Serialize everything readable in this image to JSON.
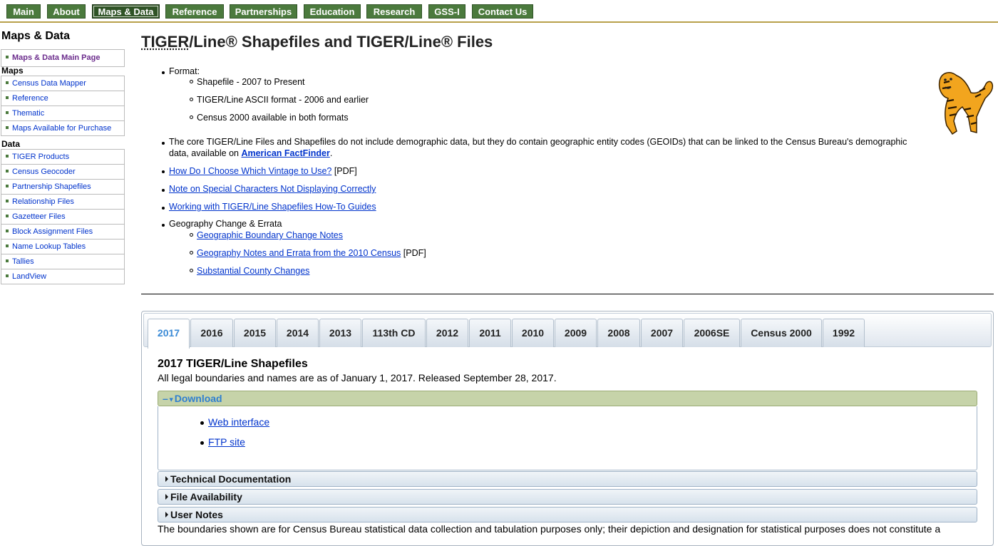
{
  "nav": {
    "items": [
      "Main",
      "About",
      "Maps & Data",
      "Reference",
      "Partnerships",
      "Education",
      "Research",
      "GSS-I",
      "Contact Us"
    ],
    "active": "Maps & Data"
  },
  "sidebar": {
    "heading": "Maps & Data",
    "main_link": "Maps & Data Main Page",
    "maps_heading": "Maps",
    "maps_items": [
      "Census Data Mapper",
      "Reference",
      "Thematic",
      "Maps Available for Purchase"
    ],
    "data_heading": "Data",
    "data_items": [
      "TIGER Products",
      "Census Geocoder",
      "Partnership Shapefiles",
      "Relationship Files",
      "Gazetteer Files",
      "Block Assignment Files",
      "Name Lookup Tables",
      "Tallies",
      "LandView"
    ]
  },
  "page": {
    "title_tiger": "TIGER",
    "title_rest": "/Line® Shapefiles and TIGER/Line® Files",
    "format_label": "Format:",
    "format_items": [
      "Shapefile - 2007 to Present",
      "TIGER/Line ASCII format - 2006 and earlier",
      "Census 2000 available in both formats"
    ],
    "core_text_1": "The core TIGER/Line Files and Shapefiles do not include demographic data, but they do contain geographic entity codes (GEOIDs) that can be linked to the Census Bureau's demographic",
    "core_text_2": "data, available on ",
    "core_link": "American FactFinder",
    "core_end": ".",
    "vintage_link": "How Do I Choose Which Vintage to Use?",
    "pdf_tag": " [PDF]",
    "special_chars_link": "Note on Special Characters Not Displaying Correctly",
    "howto_link": "Working with TIGER/Line Shapefiles How-To Guides",
    "geo_change_label": "Geography Change & Errata",
    "geo_boundary_link": "Geographic Boundary Change Notes",
    "geo_notes_link": "Geography Notes and Errata from the 2010 Census",
    "geo_notes_pdf": " [PDF]",
    "county_link": "Substantial County Changes"
  },
  "tabs": {
    "items": [
      "2017",
      "2016",
      "2015",
      "2014",
      "2013",
      "113th CD",
      "2012",
      "2011",
      "2010",
      "2009",
      "2008",
      "2007",
      "2006SE",
      "Census 2000",
      "1992"
    ],
    "active": "2017"
  },
  "panel": {
    "title": "2017 TIGER/Line Shapefiles",
    "subtitle": "All legal boundaries and names are as of January 1, 2017. Released September 28, 2017.",
    "download_label": "Download",
    "download_prefix": "–",
    "download_links": [
      "Web interface",
      "FTP site"
    ],
    "tech_doc": "Technical Documentation",
    "file_avail": "File Availability",
    "user_notes": "User Notes",
    "footer": "The boundaries shown are for Census Bureau statistical data collection and tabulation purposes only; their depiction and designation for statistical purposes does not constitute a"
  },
  "colors": {
    "nav_bg": "#4b7a3d",
    "accent_rule": "#b8a04a",
    "link": "#0033cc",
    "active_tab_text": "#3a8ad6",
    "download_header_bg": "#c6d3a9"
  }
}
